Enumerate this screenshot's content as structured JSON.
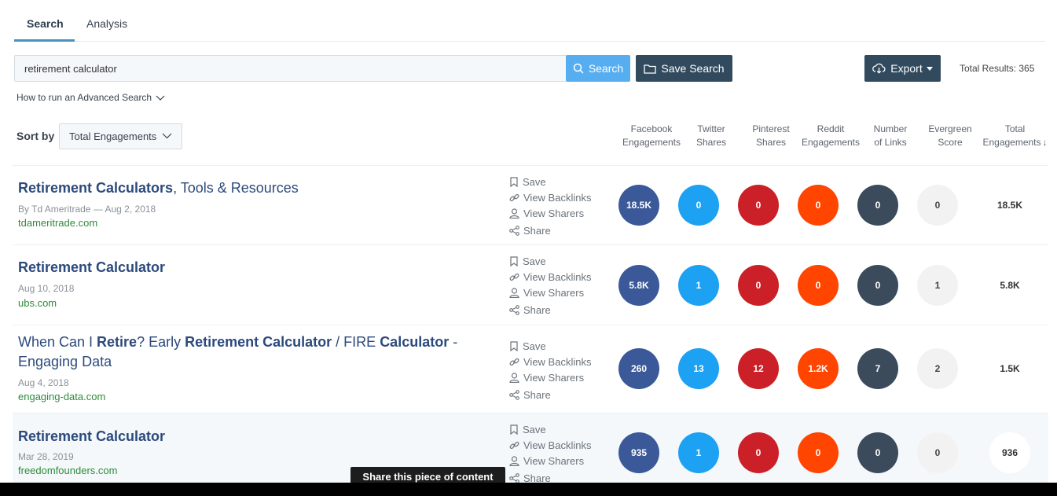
{
  "tabs": {
    "search": "Search",
    "analysis": "Analysis"
  },
  "search": {
    "value": "retirement calculator",
    "button": "Search",
    "save_button": "Save Search"
  },
  "export": {
    "label": "Export"
  },
  "total_results": "Total Results: 365",
  "advanced": "How to run an Advanced Search",
  "sort": {
    "label": "Sort by",
    "value": "Total Engagements"
  },
  "columns": {
    "fb": [
      "Facebook",
      "Engagements"
    ],
    "tw": [
      "Twitter",
      "Shares"
    ],
    "pin": [
      "Pinterest",
      "Shares"
    ],
    "reddit": [
      "Reddit",
      "Engagements"
    ],
    "links": [
      "Number",
      "of Links"
    ],
    "evergreen": [
      "Evergreen",
      "Score"
    ],
    "total": [
      "Total",
      "Engagements",
      "↓"
    ]
  },
  "actions": {
    "save": "Save",
    "backlinks": "View Backlinks",
    "sharers": "View Sharers",
    "share": "Share"
  },
  "results": [
    {
      "title_parts": [
        {
          "t": "Retirement Calculators",
          "b": true
        },
        {
          "t": ", Tools & Resources",
          "b": false
        }
      ],
      "meta": "By Td Ameritrade — Aug 2, 2018",
      "domain": "tdameritrade.com",
      "fb": "18.5K",
      "tw": "0",
      "pin": "0",
      "reddit": "0",
      "links": "0",
      "evergreen": "0",
      "total": "18.5K"
    },
    {
      "title_parts": [
        {
          "t": "Retirement Calculator",
          "b": true
        }
      ],
      "meta": "Aug 10, 2018",
      "domain": "ubs.com",
      "fb": "5.8K",
      "tw": "1",
      "pin": "0",
      "reddit": "0",
      "links": "0",
      "evergreen": "1",
      "total": "5.8K"
    },
    {
      "title_parts": [
        {
          "t": "When Can I ",
          "b": false
        },
        {
          "t": "Retire",
          "b": true
        },
        {
          "t": "? Early ",
          "b": false
        },
        {
          "t": "Retirement Calculator",
          "b": true
        },
        {
          "t": " / FIRE ",
          "b": false
        },
        {
          "t": "Calculator",
          "b": true
        },
        {
          "t": " - Engaging Data",
          "b": false
        }
      ],
      "meta": "Aug 4, 2018",
      "domain": "engaging-data.com",
      "fb": "260",
      "tw": "13",
      "pin": "12",
      "reddit": "1.2K",
      "links": "7",
      "evergreen": "2",
      "total": "1.5K"
    },
    {
      "title_parts": [
        {
          "t": "Retirement Calculator",
          "b": true
        }
      ],
      "meta": "Mar 28, 2019",
      "domain": "freedomfounders.com",
      "fb": "935",
      "tw": "1",
      "pin": "0",
      "reddit": "0",
      "links": "0",
      "evergreen": "0",
      "total": "936"
    }
  ],
  "tooltip": "Share this piece of content",
  "colors": {
    "fb": "#3b5998",
    "tw": "#1da1f2",
    "pin": "#cb2027",
    "reddit": "#ff4500",
    "links": "#3c4b5c",
    "accent": "#56aef0",
    "dark": "#324a5e"
  }
}
